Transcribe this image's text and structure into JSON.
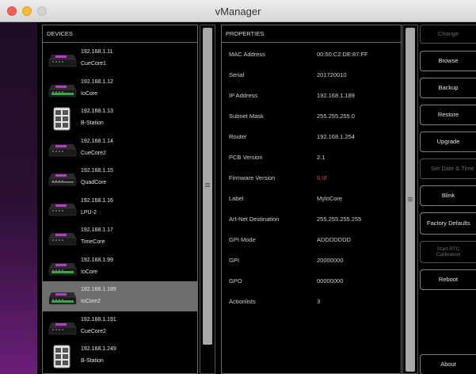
{
  "window": {
    "title": "vManager"
  },
  "devices": {
    "header": "DEVICES",
    "items": [
      {
        "ip": "192.168.1.11",
        "name": "CueCore1",
        "icon": "cuecore-device-icon"
      },
      {
        "ip": "192.168.1.12",
        "name": "IoCore",
        "icon": "iocore-device-icon"
      },
      {
        "ip": "192.168.1.13",
        "name": "B-Station",
        "icon": "bstation-device-icon"
      },
      {
        "ip": "192.168.1.14",
        "name": "CueCore2",
        "icon": "cuecore-device-icon"
      },
      {
        "ip": "192.168.1.15",
        "name": "QuadCore",
        "icon": "quadcore-device-icon"
      },
      {
        "ip": "192.168.1.16",
        "name": "LPU-2",
        "icon": "lpu-device-icon"
      },
      {
        "ip": "192.168.1.17",
        "name": "TimeCore",
        "icon": "timecore-device-icon"
      },
      {
        "ip": "192.168.1.99",
        "name": "IoCore",
        "icon": "iocore-device-icon"
      },
      {
        "ip": "192.168.1.189",
        "name": "IoCore2",
        "icon": "iocore-device-icon",
        "selected": true
      },
      {
        "ip": "192.168.1.191",
        "name": "CueCore2",
        "icon": "cuecore-device-icon"
      },
      {
        "ip": "192.168.1.249",
        "name": "B-Station",
        "icon": "bstation-device-icon"
      }
    ]
  },
  "properties": {
    "header": "PROPERTIES",
    "rows": [
      {
        "key": "MAC Address",
        "value": "00:50:C2:DE:87:FF"
      },
      {
        "key": "Serial",
        "value": "201720010"
      },
      {
        "key": "IP Address",
        "value": "192.168.1.189"
      },
      {
        "key": "Subnet Mask",
        "value": "255.255.255.0"
      },
      {
        "key": "Router",
        "value": "192.168.1.254"
      },
      {
        "key": "PCB Version",
        "value": "2.1"
      },
      {
        "key": "Firmware Version",
        "value": "0.0f",
        "highlight": "#e53a32"
      },
      {
        "key": "Label",
        "value": "MyloCore"
      },
      {
        "key": "Art-Net Destination",
        "value": "255.255.255.255"
      },
      {
        "key": "GPI Mode",
        "value": "ADDDDDDD"
      },
      {
        "key": "GPI",
        "value": "20000000"
      },
      {
        "key": "GPO",
        "value": "00000000"
      },
      {
        "key": "Actionlists",
        "value": "3"
      }
    ]
  },
  "actions": {
    "change": {
      "label": "Change",
      "enabled": false
    },
    "browse": {
      "label": "Browse",
      "enabled": true
    },
    "backup": {
      "label": "Backup",
      "enabled": true
    },
    "restore": {
      "label": "Restore",
      "enabled": true
    },
    "upgrade": {
      "label": "Upgrade",
      "enabled": true
    },
    "set_date_time": {
      "label": "Set Date & Time",
      "enabled": false
    },
    "blink": {
      "label": "Blink",
      "enabled": true
    },
    "factory_defaults": {
      "label": "Factory Defaults",
      "enabled": true
    },
    "rtc_calibration": {
      "label_line1": "Start RTC",
      "label_line2": "Calibration",
      "enabled": false
    },
    "reboot": {
      "label": "Reboot",
      "enabled": true
    },
    "about": {
      "label": "About",
      "enabled": true
    }
  },
  "colors": {
    "accent_device": "#b83cc8",
    "selection": "#6e6e6e",
    "warning": "#e53a32"
  }
}
